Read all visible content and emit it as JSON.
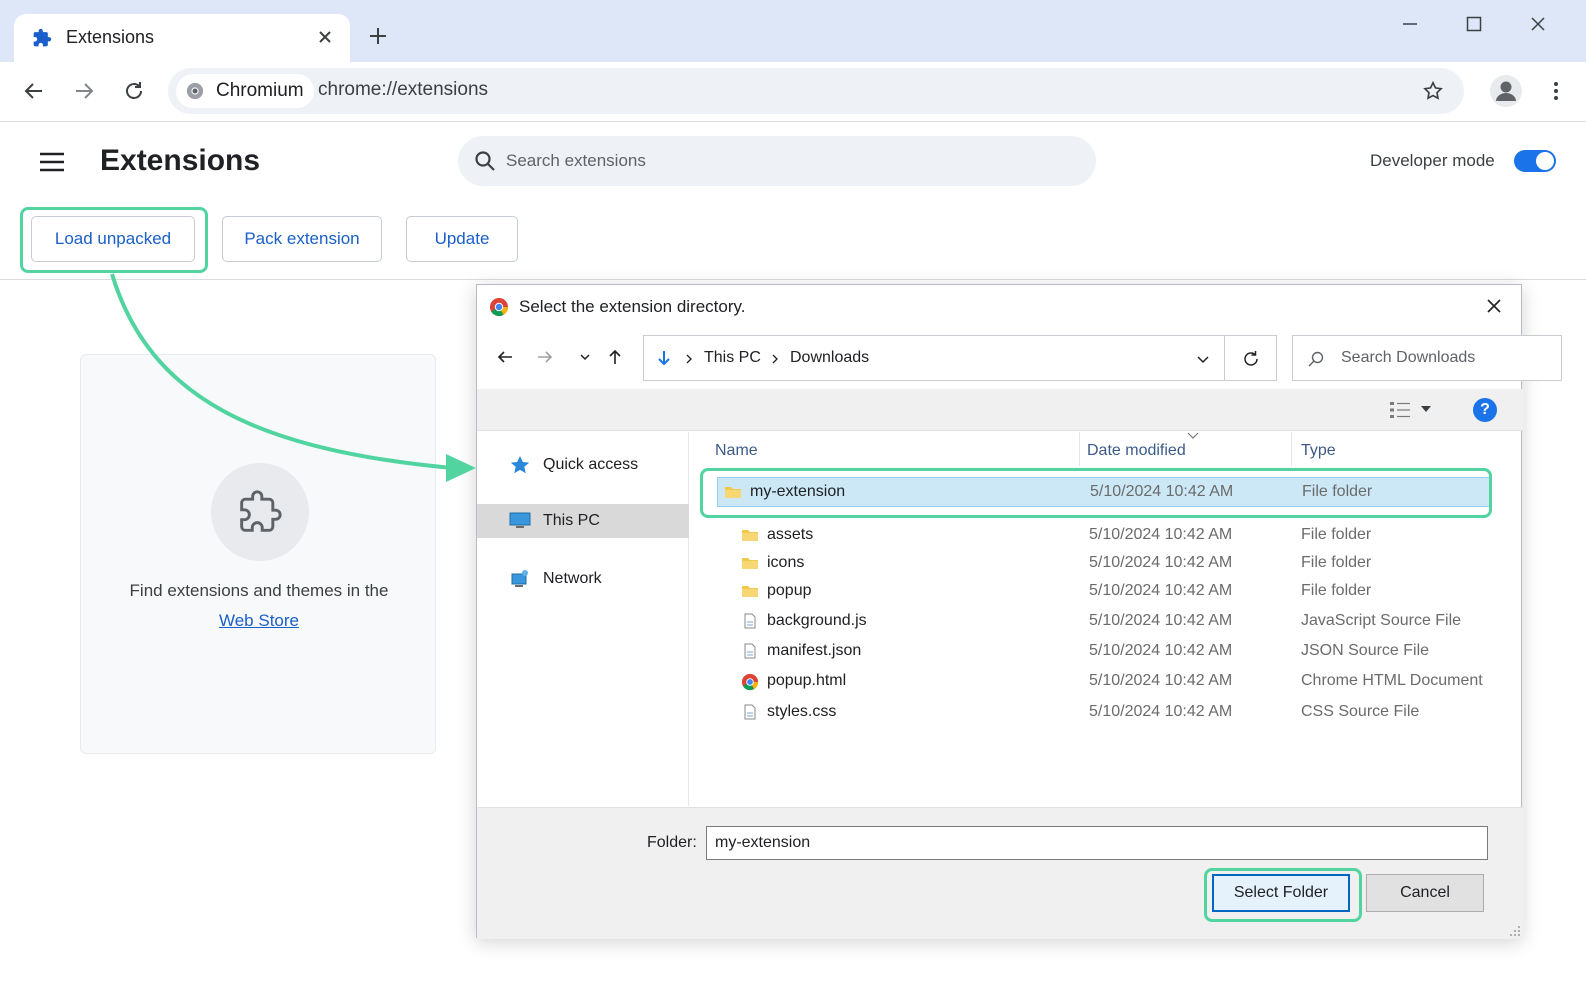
{
  "browser": {
    "tab_title": "Extensions",
    "site_chip": "Chromium",
    "url": "chrome://extensions"
  },
  "extensions_page": {
    "title": "Extensions",
    "search_placeholder": "Search extensions",
    "developer_mode_label": "Developer mode",
    "developer_mode_on": true,
    "buttons": {
      "load_unpacked": "Load unpacked",
      "pack_extension": "Pack extension",
      "update": "Update"
    },
    "empty_state": {
      "text": "Find extensions and themes in the",
      "link": "Web Store"
    }
  },
  "dialog": {
    "title": "Select the extension directory.",
    "breadcrumbs": [
      "This PC",
      "Downloads"
    ],
    "search_placeholder": "Search Downloads",
    "help_glyph": "?",
    "nav_items": [
      "Quick access",
      "This PC",
      "Network"
    ],
    "columns": {
      "name": "Name",
      "date": "Date modified",
      "type": "Type"
    },
    "files": [
      {
        "name": "my-extension",
        "date": "5/10/2024 10:42 AM",
        "type": "File folder",
        "icon": "folder-icon"
      },
      {
        "name": "assets",
        "date": "5/10/2024 10:42 AM",
        "type": "File folder",
        "icon": "folder-icon"
      },
      {
        "name": "icons",
        "date": "5/10/2024 10:42 AM",
        "type": "File folder",
        "icon": "folder-icon"
      },
      {
        "name": "popup",
        "date": "5/10/2024 10:42 AM",
        "type": "File folder",
        "icon": "folder-icon"
      },
      {
        "name": "background.js",
        "date": "5/10/2024 10:42 AM",
        "type": "JavaScript Source File",
        "icon": "file-icon"
      },
      {
        "name": "manifest.json",
        "date": "5/10/2024 10:42 AM",
        "type": "JSON Source File",
        "icon": "file-icon"
      },
      {
        "name": "popup.html",
        "date": "5/10/2024 10:42 AM",
        "type": "Chrome HTML Document",
        "icon": "chrome-icon"
      },
      {
        "name": "styles.css",
        "date": "5/10/2024 10:42 AM",
        "type": "CSS Source File",
        "icon": "file-icon"
      }
    ],
    "folder_label": "Folder:",
    "folder_value": "my-extension",
    "select_button": "Select Folder",
    "cancel_button": "Cancel"
  },
  "colors": {
    "accent": "#1a73e8",
    "highlight": "#52d4a1",
    "link": "#1a5fc9",
    "selection": "#cce8f6"
  }
}
